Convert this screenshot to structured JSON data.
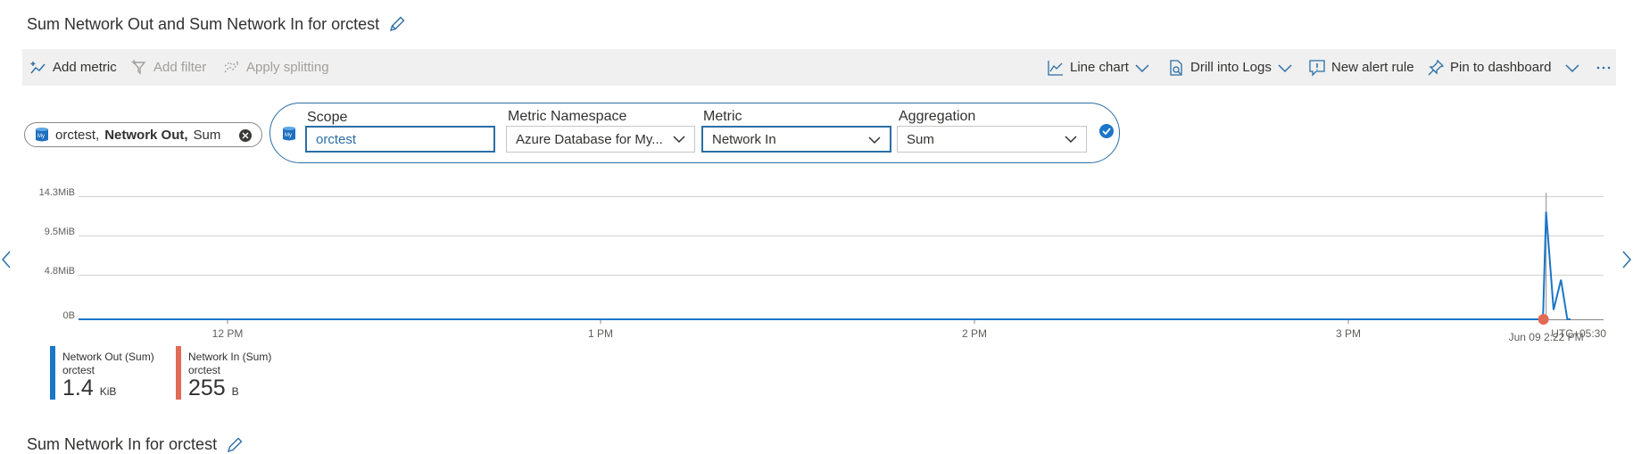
{
  "panel1": {
    "title": "Sum Network Out and Sum Network In for orctest"
  },
  "toolbar": {
    "add_metric": "Add metric",
    "add_filter": "Add filter",
    "apply_splitting": "Apply splitting",
    "line_chart": "Line chart",
    "drill_logs": "Drill into Logs",
    "new_alert": "New alert rule",
    "pin_dashboard": "Pin to dashboard"
  },
  "pill": {
    "resource": "orctest,",
    "metric": "Network Out,",
    "agg": "Sum"
  },
  "editor": {
    "scope_label": "Scope",
    "scope_value": "orctest",
    "namespace_label": "Metric Namespace",
    "namespace_value": "Azure Database for My...",
    "metric_label": "Metric",
    "metric_value": "Network In",
    "aggregation_label": "Aggregation",
    "aggregation_value": "Sum"
  },
  "chart_data": {
    "type": "line",
    "y_ticks": [
      "14.3MiB",
      "9.5MiB",
      "4.8MiB",
      "0B"
    ],
    "x_ticks": [
      "12 PM",
      "1 PM",
      "2 PM",
      "3 PM"
    ],
    "hover_label": "Jun 09 2:22 PM",
    "timezone": "UTC+05:30",
    "ylim_mib": [
      0,
      14.3
    ],
    "series": [
      {
        "name": "Network Out (Sum)",
        "color": "#1b75c8",
        "points_min_mib": [
          [
            0,
            0
          ],
          [
            1379,
            0
          ],
          [
            1382,
            12.5
          ],
          [
            1389,
            1.1
          ],
          [
            1396,
            4.6
          ],
          [
            1402,
            0
          ],
          [
            1405,
            0
          ]
        ]
      },
      {
        "name": "Network In (Sum)",
        "color": "#e06a55",
        "points_min_mib": [
          [
            0,
            0
          ],
          [
            244,
            0
          ]
        ]
      }
    ],
    "hover_minute": 1382
  },
  "legend": [
    {
      "name": "Network Out (Sum)",
      "resource": "orctest",
      "value": "1.4",
      "unit": "KiB",
      "color": "#1b75c8"
    },
    {
      "name": "Network In (Sum)",
      "resource": "orctest",
      "value": "255",
      "unit": "B",
      "color": "#e06a55"
    }
  ],
  "panel2": {
    "title": "Sum Network In for orctest"
  }
}
